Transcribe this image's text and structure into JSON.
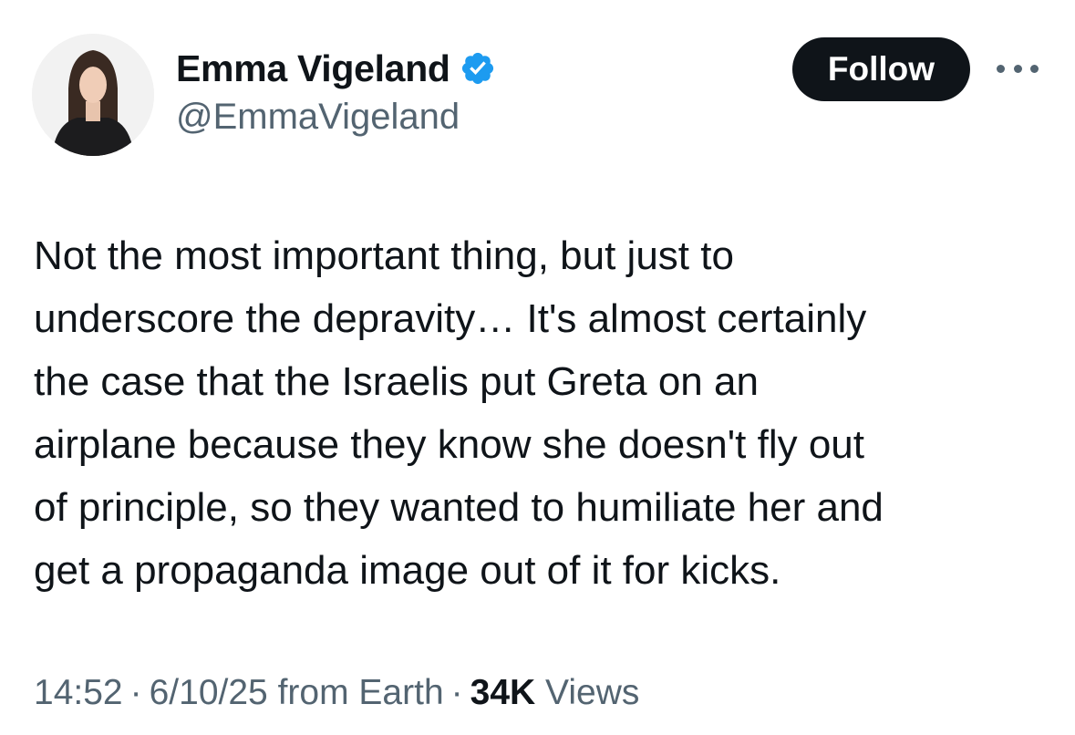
{
  "author": {
    "display_name": "Emma Vigeland",
    "handle": "@EmmaVigeland",
    "verified_badge_icon": "verified-badge-icon",
    "verified_badge_color": "#1d9bf0"
  },
  "actions": {
    "follow_label": "Follow",
    "more_icon": "more-options-icon"
  },
  "tweet": {
    "text_lines": [
      "Not the most important thing, but just to",
      "underscore the depravity… It's almost certainly",
      "the case that the Israelis put Greta on an",
      "airplane because they know she doesn't fly out",
      "of principle, so they wanted to humiliate her and",
      "get a propaganda image out of it for kicks."
    ]
  },
  "meta": {
    "time": "14:52",
    "separator": "·",
    "date": "6/10/25",
    "source": "from Earth",
    "views_count": "34K",
    "views_label": "Views"
  },
  "colors": {
    "text_primary": "#0f1419",
    "text_secondary": "#536471",
    "follow_bg": "#0f1419",
    "follow_text": "#ffffff"
  }
}
